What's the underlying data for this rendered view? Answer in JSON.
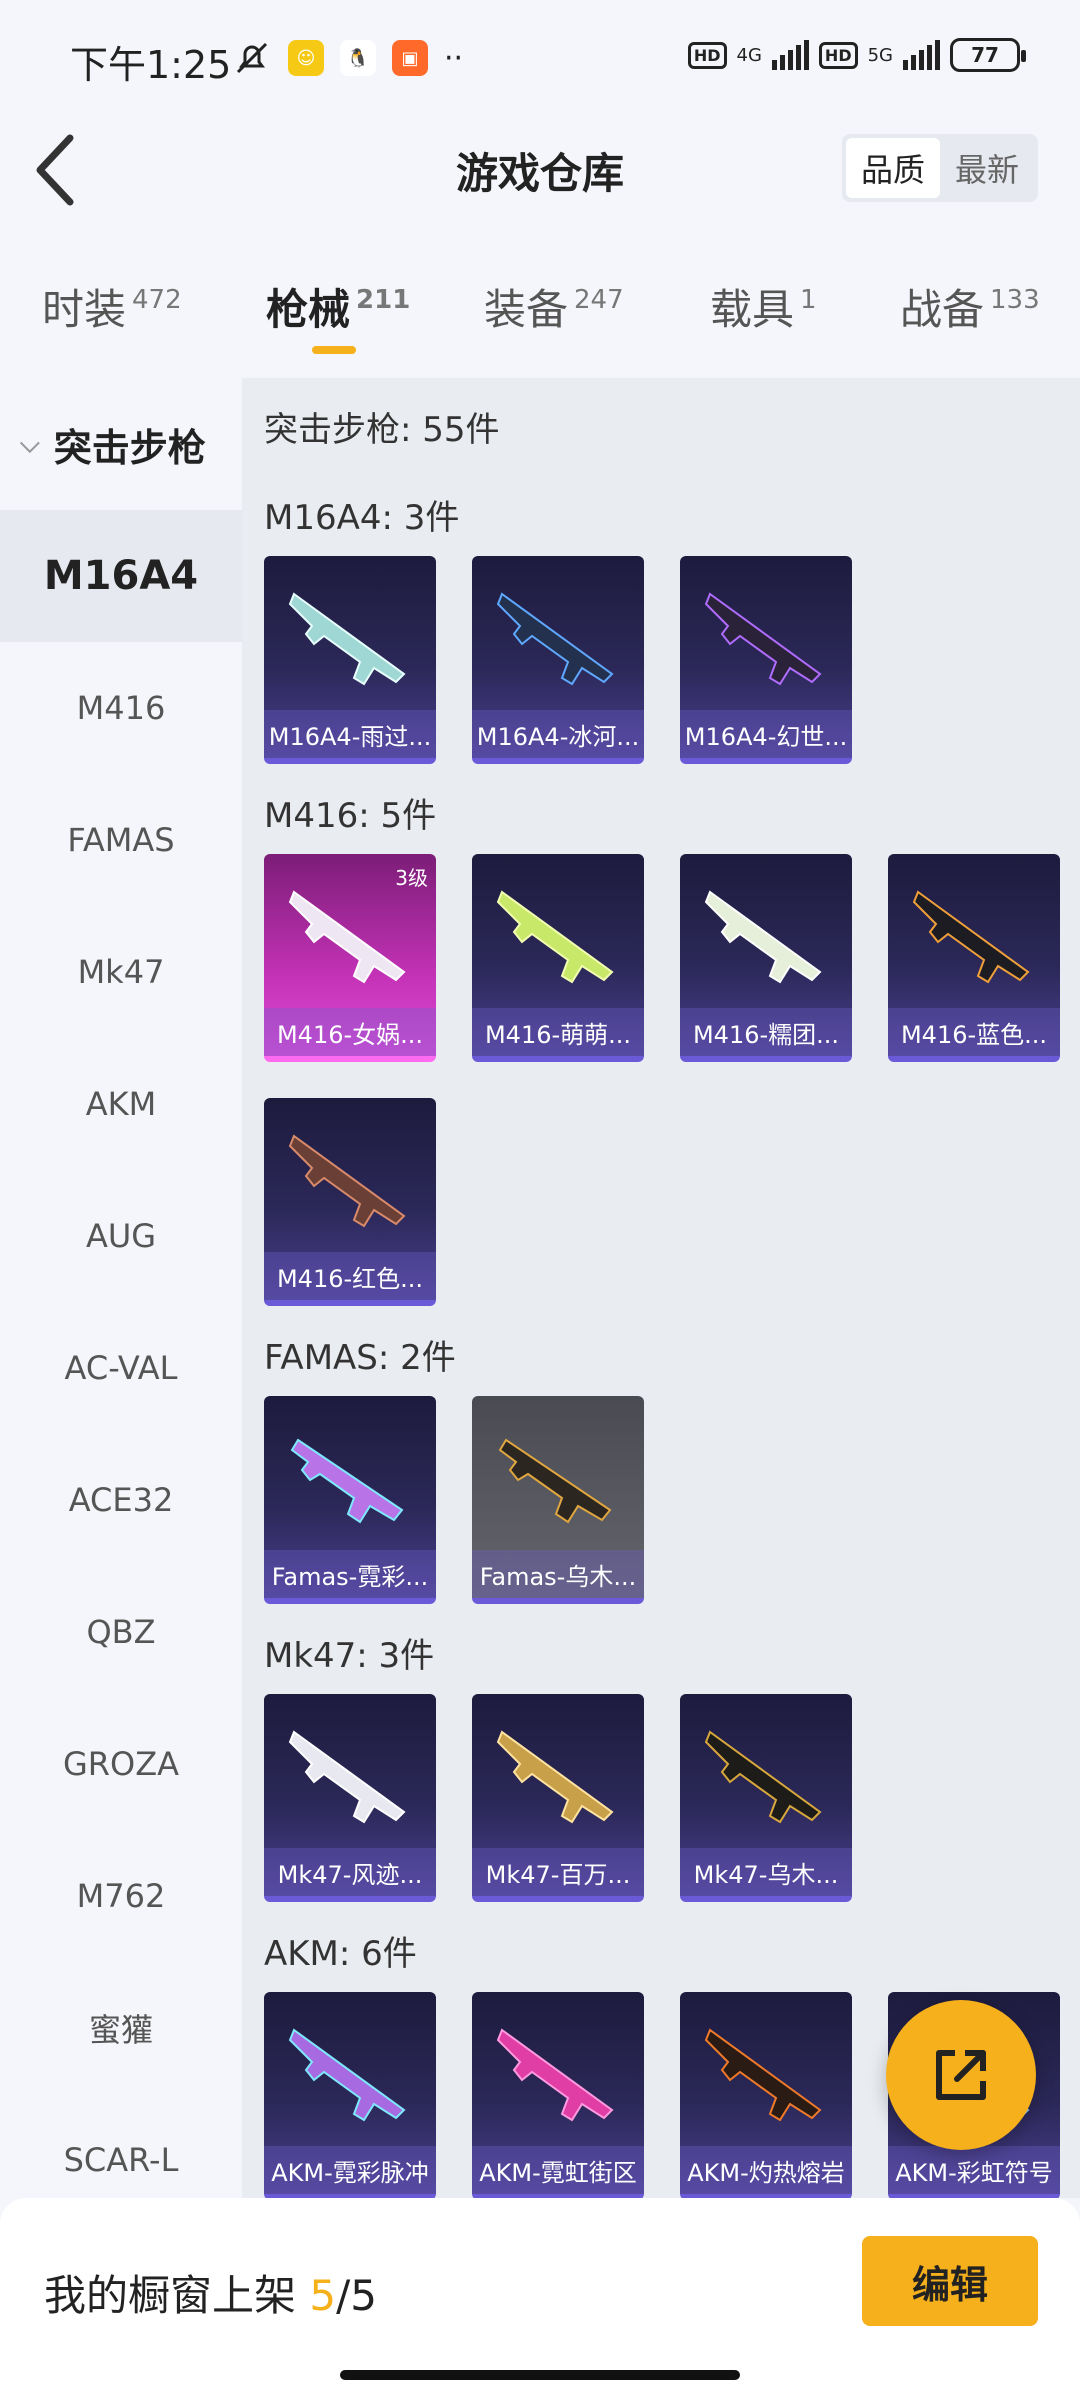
{
  "status_bar": {
    "time": "下午1:25",
    "net1": "4G",
    "net2": "5G",
    "battery": "77"
  },
  "header": {
    "title": "游戏仓库",
    "sort_options": [
      "品质",
      "最新"
    ]
  },
  "tabs": [
    {
      "label": "时装",
      "count": "472"
    },
    {
      "label": "枪械",
      "count": "211"
    },
    {
      "label": "装备",
      "count": "247"
    },
    {
      "label": "载具",
      "count": "1"
    },
    {
      "label": "战备",
      "count": "133"
    }
  ],
  "sidebar": {
    "group": "突击步枪",
    "items": [
      "M16A4",
      "M416",
      "FAMAS",
      "Mk47",
      "AKM",
      "AUG",
      "AC-VAL",
      "ACE32",
      "QBZ",
      "GROZA",
      "M762",
      "蜜獾",
      "SCAR-L"
    ]
  },
  "content": {
    "header": "突击步枪: 55件",
    "sections": [
      {
        "title": "M16A4: 3件",
        "items": [
          "M16A4-雨过...",
          "M16A4-冰河...",
          "M16A4-幻世..."
        ]
      },
      {
        "title": "M416: 5件",
        "items": [
          "M416-女娲...",
          "M416-萌萌...",
          "M416-糯团...",
          "M416-蓝色...",
          "M416-红色..."
        ],
        "badge": "3级"
      },
      {
        "title": "FAMAS: 2件",
        "items": [
          "Famas-霓彩...",
          "Famas-乌木..."
        ]
      },
      {
        "title": "Mk47: 3件",
        "items": [
          "Mk47-风迹...",
          "Mk47-百万...",
          "Mk47-乌木..."
        ]
      },
      {
        "title": "AKM: 6件",
        "items": [
          "AKM-霓彩脉冲",
          "AKM-霓虹街区",
          "AKM-灼热熔岩",
          "AKM-彩虹符号"
        ]
      }
    ]
  },
  "bottom": {
    "label": "我的橱窗上架 ",
    "current": "5",
    "total": "/5",
    "edit": "编辑"
  },
  "colors": {
    "accent": "#f5b01b",
    "card_purple": "#2b2858",
    "card_pink": "#c332b6"
  }
}
